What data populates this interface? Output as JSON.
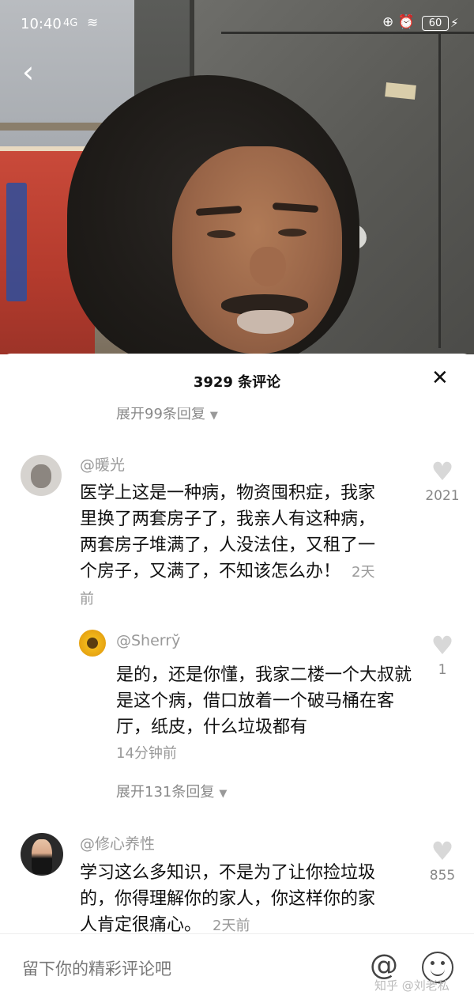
{
  "status_bar": {
    "time": "10:40",
    "signal": "4G",
    "battery": "60"
  },
  "comments_header": {
    "title": "3929 条评论"
  },
  "top_expand": {
    "label": "展开99条回复"
  },
  "comments": [
    {
      "user": "@暖光",
      "text": "医学上这是一种病，物资囤积症，我家里换了两套房子了，我亲人有这种病，两套房子堆满了，人没法住，又租了一个房子，又满了，不知该怎么办！",
      "time": "2天前",
      "likes": "2021"
    },
    {
      "user": "@Sherry̆",
      "text": "是的，还是你懂，我家二楼一个大叔就是这个病，借口放着一个破马桶在客厅，纸皮，什么垃圾都有",
      "time": "14分钟前",
      "likes": "1"
    },
    {
      "user": "@修心养性",
      "text": "学习这么多知识，不是为了让你捡垃圾的，你得理解你的家人，你这样你的家人肯定很痛心。",
      "time": "2天前",
      "likes": "855"
    }
  ],
  "reply_expand": {
    "label": "展开131条回复"
  },
  "input": {
    "placeholder": "留下你的精彩评论吧"
  },
  "watermark": "知乎 @刘老私",
  "icons": {
    "back": "back-arrow-icon",
    "close": "close-icon",
    "like": "heart-icon",
    "mention": "at-icon",
    "emoji": "emoji-icon",
    "expand": "chevron-down-icon"
  }
}
